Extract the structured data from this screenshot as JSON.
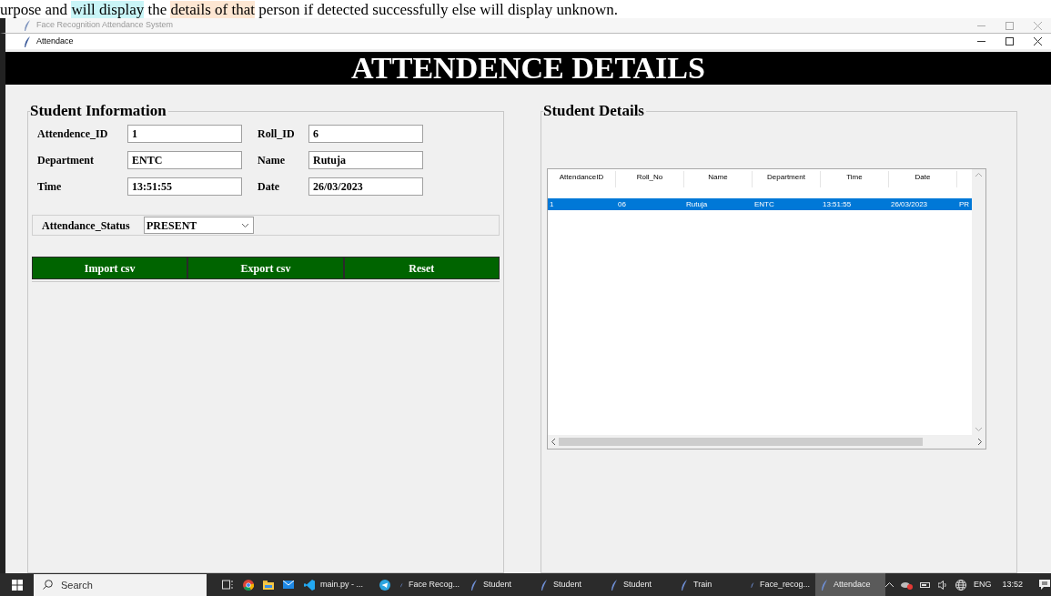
{
  "background_document": {
    "segments": [
      {
        "text": "urpose and "
      },
      {
        "text": "will display",
        "color": "#c9f5f7"
      },
      {
        "text": " the "
      },
      {
        "text": "details of that",
        "color": "#fde6d2"
      },
      {
        "text": " person if detected successfully else will display unknown."
      }
    ]
  },
  "outer_window": {
    "title": "Face Recognition Attendance System",
    "active": false
  },
  "window": {
    "title": "Attendace",
    "active": true
  },
  "header": {
    "title": "ATTENDENCE DETAILS"
  },
  "student_information": {
    "title": "Student Information",
    "fields": [
      {
        "label": "Attendence_ID",
        "value": "1"
      },
      {
        "label": "Roll_ID",
        "value": "6"
      },
      {
        "label": "Department",
        "value": "ENTC"
      },
      {
        "label": "Name",
        "value": "Rutuja"
      },
      {
        "label": "Time",
        "value": "13:51:55"
      },
      {
        "label": "Date",
        "value": "26/03/2023"
      }
    ],
    "status": {
      "label": "Attendance_Status",
      "value": "PRESENT"
    },
    "buttons": [
      "Import csv",
      "Export csv",
      "Reset"
    ]
  },
  "student_details": {
    "title": "Student Details",
    "table": {
      "columns": [
        "AttendanceID",
        "Roll_No",
        "Name",
        "Department",
        "Time",
        "Date"
      ],
      "rows": [
        {
          "cells": [
            "1",
            "06",
            "Rutuja",
            "ENTC",
            "13:51:55",
            "26/03/2023",
            "PR"
          ],
          "selected": true
        }
      ]
    }
  },
  "taskbar": {
    "search": {
      "placeholder": "Search"
    },
    "items": [
      {
        "kind": "taskview"
      },
      {
        "kind": "chrome"
      },
      {
        "kind": "folder"
      },
      {
        "kind": "mail"
      },
      {
        "kind": "vscode",
        "label": "main.py - ...",
        "selected": false
      },
      {
        "kind": "telegram"
      },
      {
        "kind": "app",
        "label": "Face Recog...",
        "selected": false
      },
      {
        "kind": "app",
        "label": "Student",
        "selected": false
      },
      {
        "kind": "app",
        "label": "Student",
        "selected": false
      },
      {
        "kind": "app",
        "label": "Student",
        "selected": false
      },
      {
        "kind": "app",
        "label": "Train",
        "selected": false
      },
      {
        "kind": "app",
        "label": "Face_recog...",
        "selected": false
      },
      {
        "kind": "app",
        "label": "Attendace",
        "selected": true
      }
    ],
    "language": "ENG",
    "clock": "13:52"
  }
}
